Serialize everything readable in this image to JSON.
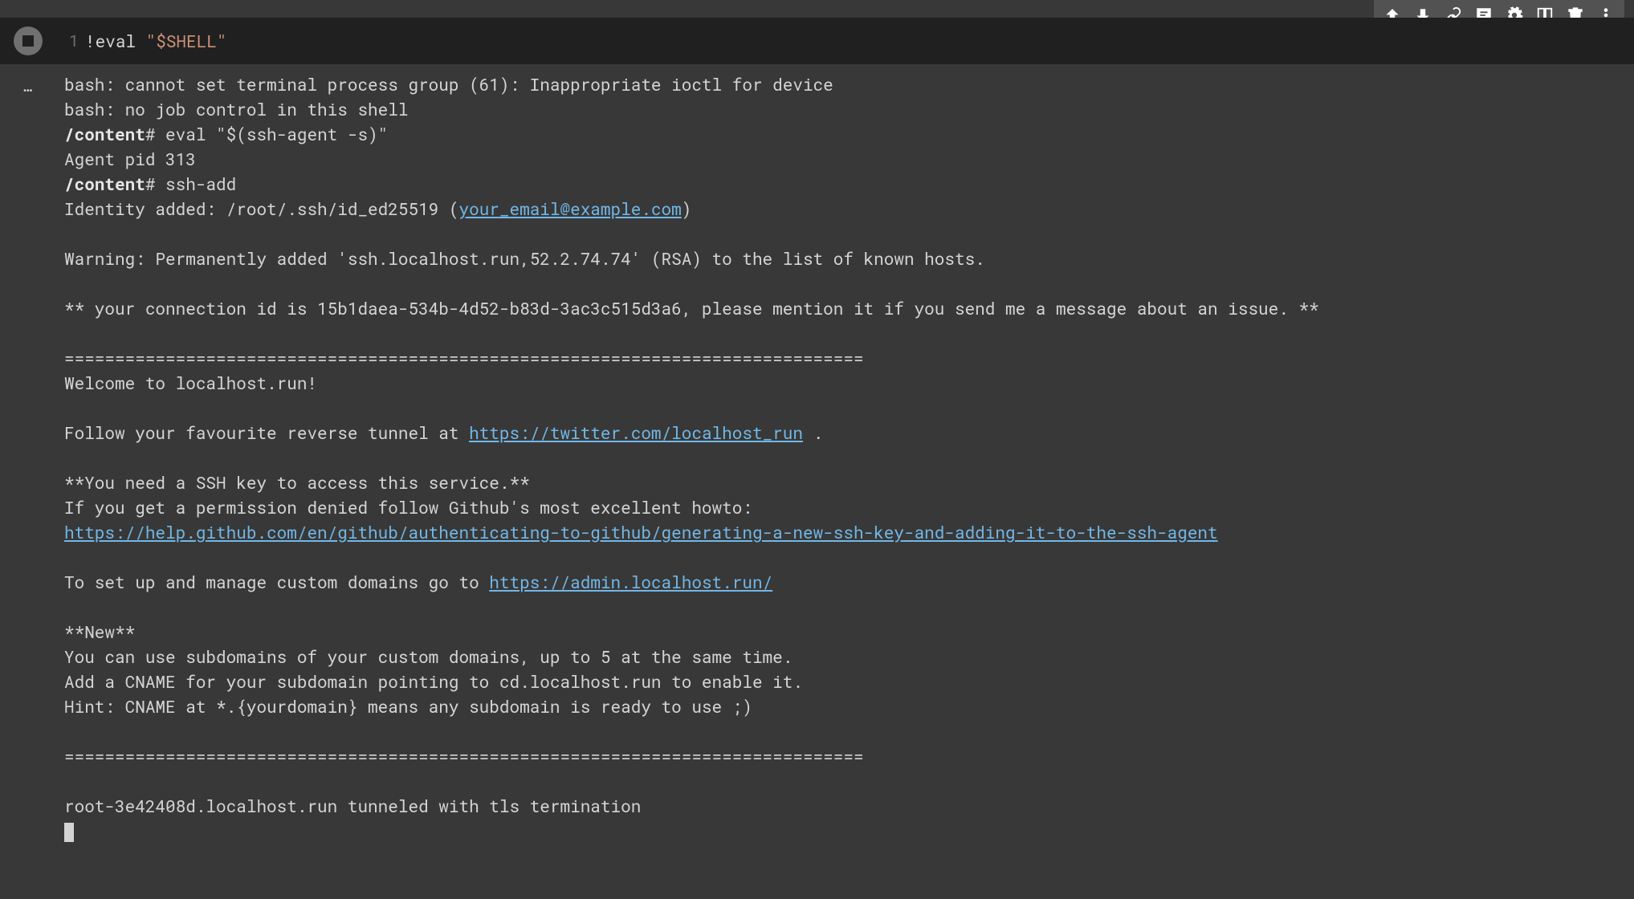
{
  "toolbar": {
    "icons": [
      "arrow-up-icon",
      "arrow-down-icon",
      "link-icon",
      "comment-icon",
      "gear-icon",
      "mirror-icon",
      "trash-icon",
      "more-icon"
    ]
  },
  "cell": {
    "line_number": "1",
    "code_prefix": "!",
    "code_call": "eval ",
    "code_string": "\"$SHELL\""
  },
  "output": {
    "collapse_label": "…",
    "line1": "bash: cannot set terminal process group (61): Inappropriate ioctl for device",
    "line2": "bash: no job control in this shell",
    "prompt1_path": "/content",
    "prompt1_cmd": "# eval \"$(ssh-agent -s)\"",
    "agent_pid": "Agent pid 313",
    "prompt2_path": "/content",
    "prompt2_cmd": "# ssh-add",
    "identity_pre": "Identity added: /root/.ssh/id_ed25519 (",
    "identity_email": "your_email@example.com",
    "identity_post": ")",
    "warning": "Warning: Permanently added 'ssh.localhost.run,52.2.74.74' (RSA) to the list of known hosts.",
    "conn_id": "** your connection id is 15b1daea-534b-4d52-b83d-3ac3c515d3a6, please mention it if you send me a message about an issue. **",
    "hr": "===============================================================================",
    "welcome": "Welcome to localhost.run!",
    "follow_pre": "Follow your favourite reverse tunnel at ",
    "follow_link": "https://twitter.com/localhost_run",
    "follow_post": " .",
    "need_key": "**You need a SSH key to access this service.**",
    "perm_denied": "If you get a permission denied follow Github's most excellent howto:",
    "github_link": "https://help.github.com/en/github/authenticating-to-github/generating-a-new-ssh-key-and-adding-it-to-the-ssh-agent",
    "setup_pre": "To set up and manage custom domains go to ",
    "setup_link": "https://admin.localhost.run/",
    "new_label": "**New**",
    "new_line1": "You can use subdomains of your custom domains, up to 5 at the same time.",
    "new_line2": "Add a CNAME for your subdomain pointing to cd.localhost.run to enable it.",
    "new_line3": "Hint: CNAME at *.{yourdomain} means any subdomain is ready to use ;)",
    "tunnel": "root-3e42408d.localhost.run tunneled with tls termination"
  }
}
